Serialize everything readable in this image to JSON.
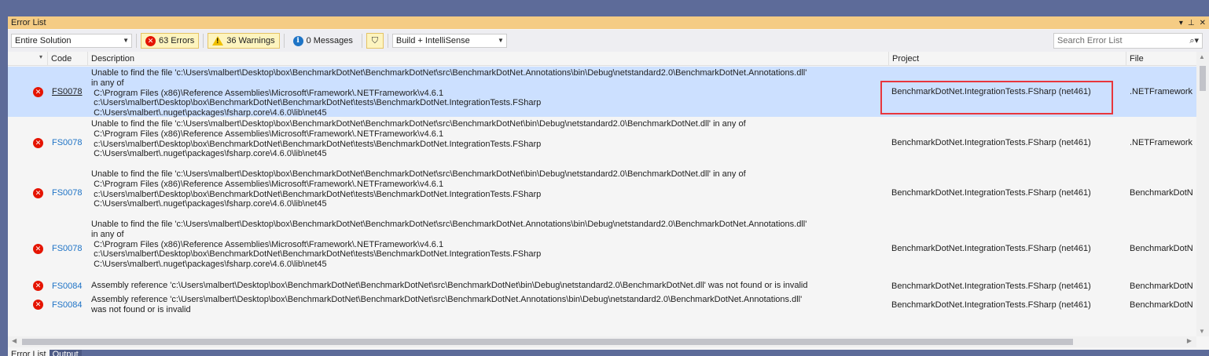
{
  "window": {
    "title": "Error List"
  },
  "toolbar": {
    "scope": "Entire Solution",
    "errors_label": "63 Errors",
    "warnings_label": "36 Warnings",
    "messages_label": "0 Messages",
    "build_filter": "Build + IntelliSense",
    "search_placeholder": "Search Error List"
  },
  "columns": {
    "code": "Code",
    "description": "Description",
    "project": "Project",
    "file": "File"
  },
  "rows": [
    {
      "code": "FS0078",
      "description": "Unable to find the file 'c:\\Users\\malbert\\Desktop\\box\\BenchmarkDotNet\\BenchmarkDotNet\\src\\BenchmarkDotNet.Annotations\\bin\\Debug\\netstandard2.0\\BenchmarkDotNet.Annotations.dll'\nin any of\n C:\\Program Files (x86)\\Reference Assemblies\\Microsoft\\Framework\\.NETFramework\\v4.6.1\n c:\\Users\\malbert\\Desktop\\box\\BenchmarkDotNet\\BenchmarkDotNet\\tests\\BenchmarkDotNet.IntegrationTests.FSharp\n C:\\Users\\malbert\\.nuget\\packages\\fsharp.core\\4.6.0\\lib\\net45",
      "project": "BenchmarkDotNet.IntegrationTests.FSharp (net461)",
      "file": ".NETFramework"
    },
    {
      "code": "FS0078",
      "description": "Unable to find the file 'c:\\Users\\malbert\\Desktop\\box\\BenchmarkDotNet\\BenchmarkDotNet\\src\\BenchmarkDotNet\\bin\\Debug\\netstandard2.0\\BenchmarkDotNet.dll' in any of\n C:\\Program Files (x86)\\Reference Assemblies\\Microsoft\\Framework\\.NETFramework\\v4.6.1\n c:\\Users\\malbert\\Desktop\\box\\BenchmarkDotNet\\BenchmarkDotNet\\tests\\BenchmarkDotNet.IntegrationTests.FSharp\n C:\\Users\\malbert\\.nuget\\packages\\fsharp.core\\4.6.0\\lib\\net45",
      "project": "BenchmarkDotNet.IntegrationTests.FSharp (net461)",
      "file": ".NETFramework"
    },
    {
      "code": "FS0078",
      "description": "Unable to find the file 'c:\\Users\\malbert\\Desktop\\box\\BenchmarkDotNet\\BenchmarkDotNet\\src\\BenchmarkDotNet\\bin\\Debug\\netstandard2.0\\BenchmarkDotNet.dll' in any of\n C:\\Program Files (x86)\\Reference Assemblies\\Microsoft\\Framework\\.NETFramework\\v4.6.1\n c:\\Users\\malbert\\Desktop\\box\\BenchmarkDotNet\\BenchmarkDotNet\\tests\\BenchmarkDotNet.IntegrationTests.FSharp\n C:\\Users\\malbert\\.nuget\\packages\\fsharp.core\\4.6.0\\lib\\net45",
      "project": "BenchmarkDotNet.IntegrationTests.FSharp (net461)",
      "file": "BenchmarkDotN"
    },
    {
      "code": "FS0078",
      "description": "Unable to find the file 'c:\\Users\\malbert\\Desktop\\box\\BenchmarkDotNet\\BenchmarkDotNet\\src\\BenchmarkDotNet.Annotations\\bin\\Debug\\netstandard2.0\\BenchmarkDotNet.Annotations.dll'\nin any of\n C:\\Program Files (x86)\\Reference Assemblies\\Microsoft\\Framework\\.NETFramework\\v4.6.1\n c:\\Users\\malbert\\Desktop\\box\\BenchmarkDotNet\\BenchmarkDotNet\\tests\\BenchmarkDotNet.IntegrationTests.FSharp\n C:\\Users\\malbert\\.nuget\\packages\\fsharp.core\\4.6.0\\lib\\net45",
      "project": "BenchmarkDotNet.IntegrationTests.FSharp (net461)",
      "file": "BenchmarkDotN"
    },
    {
      "code": "FS0084",
      "description": "Assembly reference 'c:\\Users\\malbert\\Desktop\\box\\BenchmarkDotNet\\BenchmarkDotNet\\src\\BenchmarkDotNet\\bin\\Debug\\netstandard2.0\\BenchmarkDotNet.dll' was not found or is invalid",
      "project": "BenchmarkDotNet.IntegrationTests.FSharp (net461)",
      "file": "BenchmarkDotN"
    },
    {
      "code": "FS0084",
      "description": "Assembly reference 'c:\\Users\\malbert\\Desktop\\box\\BenchmarkDotNet\\BenchmarkDotNet\\src\\BenchmarkDotNet.Annotations\\bin\\Debug\\netstandard2.0\\BenchmarkDotNet.Annotations.dll'\nwas not found or is invalid",
      "project": "BenchmarkDotNet.IntegrationTests.FSharp (net461)",
      "file": "BenchmarkDotN"
    }
  ],
  "tabs": [
    "Error List",
    "Output"
  ],
  "colors": {
    "accent_titlebar": "#f5cc84",
    "selected_row": "#cce0ff",
    "highlight": "#e8363c",
    "error_icon": "#e51400"
  }
}
